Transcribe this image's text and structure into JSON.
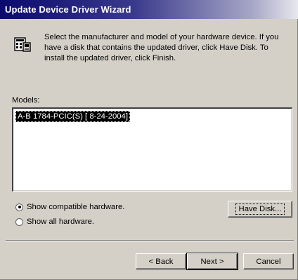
{
  "window": {
    "title": "Update Device Driver Wizard"
  },
  "intro": {
    "icon": "hardware-device-icon",
    "text": "Select the manufacturer and model of your hardware device. If you have a disk that contains the updated driver, click Have Disk. To install the updated driver, click Finish."
  },
  "models": {
    "label": "Models:",
    "items": [
      "A-B 1784-PCIC(S) [ 8-24-2004]"
    ],
    "selected_index": 0
  },
  "options": {
    "compatible_label": "Show compatible hardware.",
    "all_label": "Show all hardware.",
    "selected": "compatible"
  },
  "buttons": {
    "have_disk": "Have Disk...",
    "back": "< Back",
    "next": "Next >",
    "cancel": "Cancel"
  },
  "colors": {
    "titlebar_start": "#0a0a6e",
    "titlebar_end": "#e8e8ee",
    "face": "#d4d0c8"
  }
}
